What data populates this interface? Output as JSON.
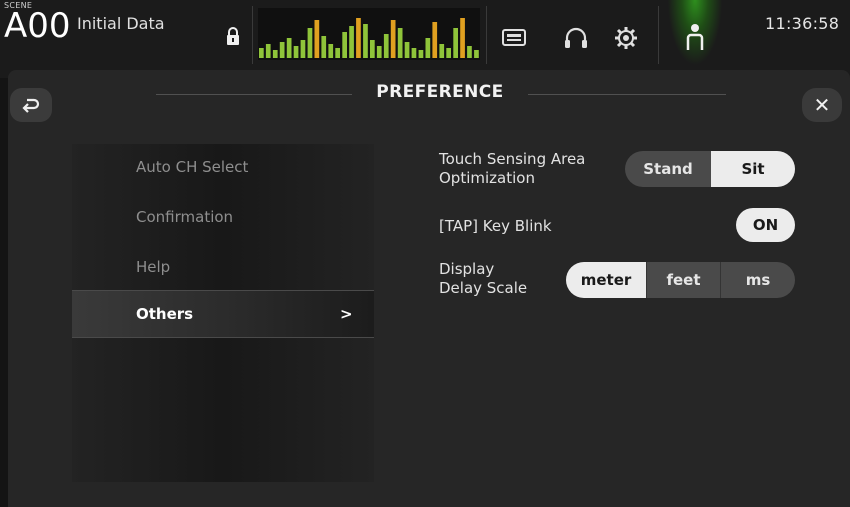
{
  "topbar": {
    "scene_tag": "SCENE",
    "scene_number": "A00",
    "scene_name": "Initial Data",
    "clock": "11:36:58",
    "icons": [
      "lock-icon",
      "level-meters",
      "recorder-icon",
      "headphones-icon",
      "gear-icon",
      "user-icon"
    ]
  },
  "panel": {
    "title": "PREFERENCE",
    "back_icon": "back-arrow-icon",
    "close_glyph": "✕"
  },
  "menu": {
    "items": [
      {
        "label": "Auto CH Select",
        "active": false
      },
      {
        "label": "Confirmation",
        "active": false
      },
      {
        "label": "Help",
        "active": false
      },
      {
        "label": "Others",
        "active": true,
        "chevron": ">"
      }
    ]
  },
  "settings": {
    "touch_sensing": {
      "label_line1": "Touch Sensing Area",
      "label_line2": "Optimization",
      "options": [
        "Stand",
        "Sit"
      ],
      "selected": "Sit"
    },
    "tap_key_blink": {
      "label": "[TAP] Key Blink",
      "value": "ON"
    },
    "display_delay_scale": {
      "label_line1": "Display",
      "label_line2": "Delay Scale",
      "options": [
        "meter",
        "feet",
        "ms"
      ],
      "selected": "meter"
    }
  },
  "colors": {
    "background": "#141414",
    "panel": "#262626",
    "accent_green": "#2e8f1e",
    "meter_green": "#8fc43a",
    "meter_peak": "#e0a020",
    "selected_segment": "#ececec"
  }
}
